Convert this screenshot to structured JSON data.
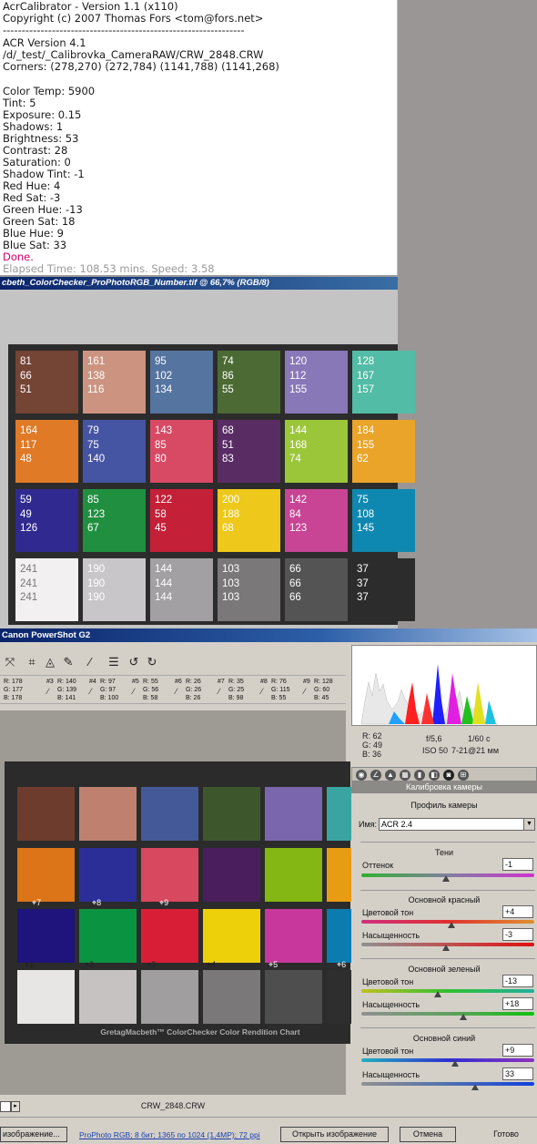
{
  "console": {
    "lines": [
      "AcrCalibrator - Version 1.1 (x110)",
      "Copyright (c) 2007 Thomas Fors <tom@fors.net>",
      "----------------------------------------------------------------",
      "ACR Version 4.1",
      "/d/_test/_Calibrovka_CameraRAW/CRW_2848.CRW",
      "Corners: (278,270) (272,784) (1141,788) (1141,268)",
      "Color Temp: 5900",
      "Tint: 5",
      "Exposure: 0.15",
      "Shadows: 1",
      "Brightness: 53",
      "Contrast: 28",
      "Saturation: 0",
      "Shadow Tint: -1",
      "Red Hue: 4",
      "Red Sat: -3",
      "Green Hue: -13",
      "Green Sat: 18",
      "Blue Hue: 9",
      "Blue Sat: 33"
    ],
    "done": "Done.",
    "elapsed": "Elapsed Time: 108.53 mins.  Speed: 3.58"
  },
  "photoshop": {
    "title": "cbeth_ColorChecker_ProPhotoRGB_Number.tif @ 66,7% (RGB/8)",
    "patches": [
      {
        "color": "#744434",
        "r": "81",
        "g": "66",
        "b": "51"
      },
      {
        "color": "#cc9480",
        "r": "161",
        "g": "138",
        "b": "116"
      },
      {
        "color": "#5674a0",
        "r": "95",
        "g": "102",
        "b": "134"
      },
      {
        "color": "#4c6a34",
        "r": "74",
        "g": "86",
        "b": "55"
      },
      {
        "color": "#8878b8",
        "r": "120",
        "g": "112",
        "b": "155"
      },
      {
        "color": "#52bca6",
        "r": "128",
        "g": "167",
        "b": "157"
      },
      {
        "color": "#e07a26",
        "r": "164",
        "g": "117",
        "b": "48"
      },
      {
        "color": "#4654a4",
        "r": "79",
        "g": "75",
        "b": "140"
      },
      {
        "color": "#d84a64",
        "r": "143",
        "g": "85",
        "b": "80"
      },
      {
        "color": "#5a2c64",
        "r": "68",
        "g": "51",
        "b": "83"
      },
      {
        "color": "#9cc63a",
        "r": "144",
        "g": "168",
        "b": "74"
      },
      {
        "color": "#eaa42a",
        "r": "184",
        "g": "155",
        "b": "62"
      },
      {
        "color": "#302a90",
        "r": "59",
        "g": "49",
        "b": "126"
      },
      {
        "color": "#209040",
        "r": "85",
        "g": "123",
        "b": "67"
      },
      {
        "color": "#c42038",
        "r": "122",
        "g": "58",
        "b": "45"
      },
      {
        "color": "#eec81a",
        "r": "200",
        "g": "188",
        "b": "68"
      },
      {
        "color": "#c84494",
        "r": "142",
        "g": "84",
        "b": "123"
      },
      {
        "color": "#0e88b0",
        "r": "75",
        "g": "108",
        "b": "145"
      },
      {
        "color": "#f2f0f0",
        "r": "241",
        "g": "241",
        "b": "241",
        "light": true
      },
      {
        "color": "#c8c6c8",
        "r": "190",
        "g": "190",
        "b": "190"
      },
      {
        "color": "#a2a0a2",
        "r": "144",
        "g": "144",
        "b": "144"
      },
      {
        "color": "#7a7878",
        "r": "103",
        "g": "103",
        "b": "103"
      },
      {
        "color": "#545454",
        "r": "66",
        "g": "66",
        "b": "66"
      },
      {
        "color": "#2c2c2c",
        "r": "37",
        "g": "37",
        "b": "37"
      }
    ]
  },
  "camera_raw": {
    "title": "Canon PowerShot G2",
    "samples": [
      {
        "hdr": "",
        "r": "R: 178",
        "g": "G: 177",
        "b": "B: 178"
      },
      {
        "hdr": "#3",
        "r": "R: 140",
        "g": "G: 139",
        "b": "B: 141"
      },
      {
        "hdr": "#4",
        "r": "R: 97",
        "g": "G: 97",
        "b": "B: 100"
      },
      {
        "hdr": "#5",
        "r": "R: 55",
        "g": "G: 56",
        "b": "B: 58"
      },
      {
        "hdr": "#6",
        "r": "R: 26",
        "g": "G: 26",
        "b": "B: 26"
      },
      {
        "hdr": "#7",
        "r": "R: 35",
        "g": "G: 25",
        "b": "B: 98"
      },
      {
        "hdr": "#8",
        "r": "R: 76",
        "g": "G: 115",
        "b": "B: 55"
      },
      {
        "hdr": "#9",
        "r": "R: 128",
        "g": "G: 60",
        "b": "B: 45"
      }
    ],
    "chart_colors": [
      "#6e3c2c",
      "#c08070",
      "#445a98",
      "#3e562c",
      "#7a66ac",
      "#3aa4a2",
      "#dc7418",
      "#2c2e98",
      "#d8485e",
      "#4a1e5c",
      "#84b614",
      "#e89c14",
      "#1e147c",
      "#0a9442",
      "#d81e36",
      "#eed00a",
      "#c8389c",
      "#0a7cb0",
      "#e8e6e4",
      "#c6c2c2",
      "#a09e9e",
      "#7a7878",
      "#4e4e4e",
      "#2e2e2e"
    ],
    "targets": [
      {
        "label": "7",
        "dark": false
      },
      {
        "label": "8",
        "dark": false
      },
      {
        "label": "9",
        "dark": false
      },
      {
        "label": "1",
        "dark": true
      },
      {
        "label": "2",
        "dark": true
      },
      {
        "label": "3",
        "dark": true
      },
      {
        "label": "4",
        "dark": true
      },
      {
        "label": "5",
        "dark": false
      },
      {
        "label": "6",
        "dark": false
      }
    ],
    "chart_caption": "GretagMacbeth™ ColorChecker Color Rendition Chart",
    "filename": "CRW_2848.CRW",
    "readout": {
      "r": "R:   62",
      "g": "G:   49",
      "b": "B:   36",
      "aperture": "f/5,6",
      "shutter": "1/60 c",
      "iso": "ISO 50",
      "lens": "7-21@21 мм"
    },
    "panel_title": "Калибровка камеры",
    "profile_heading": "Профиль камеры",
    "name_label": "Имя:",
    "profile_value": "ACR 2.4",
    "shadows_title": "Тени",
    "shadow_tint_label": "Оттенок",
    "shadow_tint_value": "-1",
    "red_title": "Основной красный",
    "red_hue_label": "Цветовой тон",
    "red_hue_value": "+4",
    "red_sat_label": "Насыщенность",
    "red_sat_value": "-3",
    "green_title": "Основной зеленый",
    "green_hue_label": "Цветовой тон",
    "green_hue_value": "-13",
    "green_sat_label": "Насыщенность",
    "green_sat_value": "+18",
    "blue_title": "Основной синий",
    "blue_hue_label": "Цветовой тон",
    "blue_hue_value": "+9",
    "blue_sat_label": "Насыщенность",
    "blue_sat_value": "33",
    "slider_levels": {
      "shadow_tint": 0.49,
      "red_hue": 0.52,
      "red_sat": 0.49,
      "green_hue": 0.44,
      "green_sat": 0.59,
      "blue_hue": 0.54,
      "blue_sat": 0.66
    }
  },
  "bottom": {
    "save_label": "изображение...",
    "workflow": "ProPhoto RGB; 8 бит; 1365 по 1024 (1,4MP); 72 ppi",
    "open_label": "Открыть изображение",
    "cancel_label": "Отмена",
    "done_label": "Готово"
  }
}
